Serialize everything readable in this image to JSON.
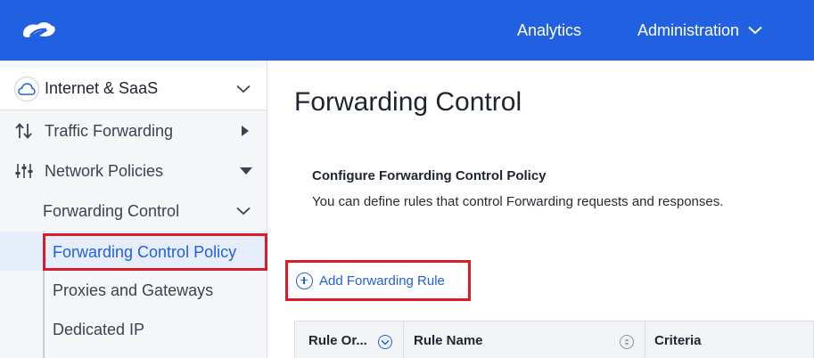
{
  "header": {
    "nav": {
      "analytics": "Analytics",
      "administration": "Administration"
    }
  },
  "sidebar": {
    "section": "Internet & SaaS",
    "items": [
      {
        "label": "Traffic Forwarding"
      },
      {
        "label": "Network Policies"
      },
      {
        "label": "Forwarding Control"
      },
      {
        "label": "Forwarding Control Policy"
      },
      {
        "label": "Proxies and Gateways"
      },
      {
        "label": "Dedicated IP"
      }
    ]
  },
  "main": {
    "title": "Forwarding Control",
    "section_title": "Configure Forwarding Control Policy",
    "section_desc": "You can define rules that control Forwarding requests and responses.",
    "add_rule": "Add Forwarding Rule",
    "table": {
      "columns": [
        "Rule Or...",
        "Rule Name",
        "Criteria"
      ]
    }
  },
  "colors": {
    "brand": "#2160e1",
    "highlight": "#d91c2a"
  }
}
